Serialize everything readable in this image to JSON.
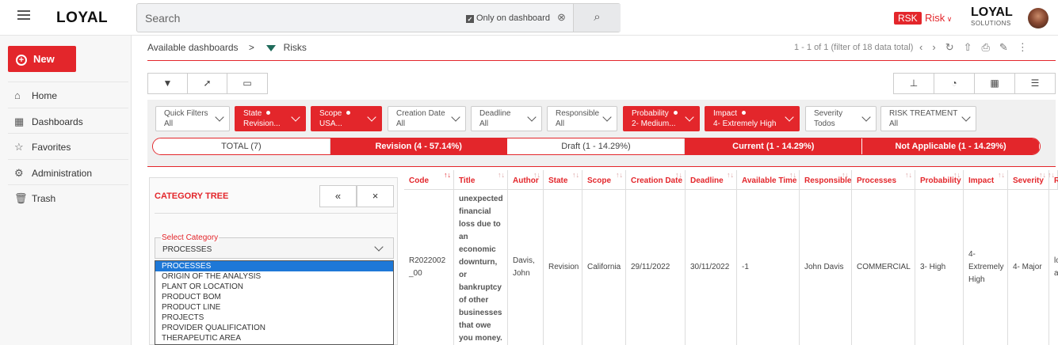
{
  "header": {
    "logo": "LOYAL",
    "search_placeholder": "Search",
    "only_dashboard": "Only on dashboard",
    "rsk": "RSK",
    "risk_menu": "Risk",
    "brand": "LOYAL",
    "brand_sub": "SOLUTIONS"
  },
  "sidebar": {
    "new_label": "New",
    "items": [
      {
        "icon": "home-icon",
        "glyph": "⌂",
        "label": "Home"
      },
      {
        "icon": "dashboards-icon",
        "glyph": "▦",
        "label": "Dashboards"
      },
      {
        "icon": "star-icon",
        "glyph": "☆",
        "label": "Favorites"
      },
      {
        "icon": "gear-icon",
        "glyph": "⚙",
        "label": "Administration"
      },
      {
        "icon": "trash-icon",
        "glyph": "🗑",
        "label": "Trash"
      }
    ]
  },
  "breadcrumb": {
    "parent": "Available dashboards",
    "sep": ">",
    "current": "Risks"
  },
  "paging": "1 - 1 of 1 (filter of 18 data total)",
  "filters": [
    {
      "label": "Quick Filters",
      "value": "All",
      "active": false
    },
    {
      "label": "State",
      "value": "Revision...",
      "active": true
    },
    {
      "label": "Scope",
      "value": "USA...",
      "active": true
    },
    {
      "label": "Creation Date",
      "value": "All",
      "active": false
    },
    {
      "label": "Deadline",
      "value": "All",
      "active": false
    },
    {
      "label": "Responsible",
      "value": "All",
      "active": false
    },
    {
      "label": "Probability",
      "value": "2- Medium...",
      "active": true
    },
    {
      "label": "Impact",
      "value": "4- Extremely High",
      "active": true
    },
    {
      "label": "Severity",
      "value": "Todos",
      "active": false
    },
    {
      "label": "RISK TREATMENT",
      "value": "All",
      "active": false
    }
  ],
  "tabs": [
    {
      "label": "TOTAL (7)",
      "active": false
    },
    {
      "label": "Revision (4 - 57.14%)",
      "active": true
    },
    {
      "label": "Draft (1 - 14.29%)",
      "active": false
    },
    {
      "label": "Current (1 - 14.29%)",
      "active": true
    },
    {
      "label": "Not Applicable (1 - 14.29%)",
      "active": true
    }
  ],
  "category_tree": {
    "title": "CATEGORY TREE",
    "collapse": "«",
    "close": "×",
    "select_label": "Select Category",
    "selected": "PROCESSES",
    "options": [
      "PROCESSES",
      "ORIGIN OF THE ANALYSIS",
      "PLANT OR LOCATION",
      "PRODUCT BOM",
      "PRODUCT LINE",
      "PROJECTS",
      "PROVIDER QUALIFICATION",
      "THERAPEUTIC AREA"
    ]
  },
  "table": {
    "columns": [
      "Code",
      "Title",
      "Author",
      "State",
      "Scope",
      "Creation Date",
      "Deadline",
      "Available Time",
      "Responsible",
      "Processes",
      "Probability",
      "Impact",
      "Severity",
      "R"
    ],
    "row": [
      "R2022002_00",
      "unexpected financial loss due to an economic downturn, or bankruptcy of other businesses that owe you money.",
      "Davis, John",
      "Revision",
      "California",
      "29/11/2022",
      "30/11/2022",
      "-1",
      "John Davis",
      "COMMERCIAL",
      "3- High",
      "4- Extremely High",
      "4- Major",
      "lo a"
    ]
  }
}
